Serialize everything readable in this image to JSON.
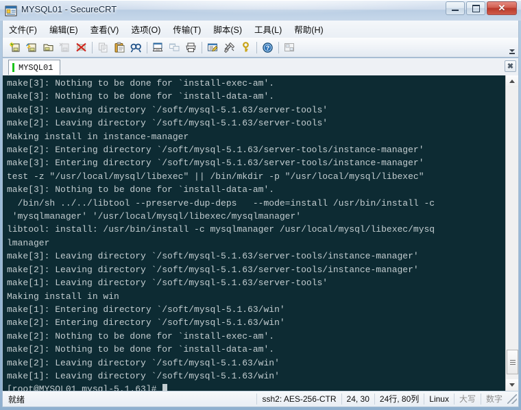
{
  "window": {
    "title": "MYSQL01 - SecureCRT",
    "icon": "securecrt-icon",
    "minimize_label": "–",
    "maximize_label": "□",
    "close_label": "✕"
  },
  "menubar": {
    "items": [
      {
        "label": "文件(F)",
        "name": "menu-file"
      },
      {
        "label": "编辑(E)",
        "name": "menu-edit"
      },
      {
        "label": "查看(V)",
        "name": "menu-view"
      },
      {
        "label": "选项(O)",
        "name": "menu-options"
      },
      {
        "label": "传输(T)",
        "name": "menu-transfer"
      },
      {
        "label": "脚本(S)",
        "name": "menu-script"
      },
      {
        "label": "工具(L)",
        "name": "menu-tools"
      },
      {
        "label": "帮助(H)",
        "name": "menu-help"
      }
    ]
  },
  "toolbar": {
    "buttons": [
      {
        "name": "new-session-icon",
        "kind": "icon"
      },
      {
        "name": "quick-connect-icon",
        "kind": "icon"
      },
      {
        "name": "connect-sftp-icon",
        "kind": "icon"
      },
      {
        "name": "reconnect-icon",
        "kind": "icon"
      },
      {
        "name": "disconnect-icon",
        "kind": "icon"
      },
      {
        "name": "separator-1",
        "kind": "sep"
      },
      {
        "name": "copy-icon",
        "kind": "icon"
      },
      {
        "name": "paste-icon",
        "kind": "icon"
      },
      {
        "name": "find-icon",
        "kind": "icon"
      },
      {
        "name": "separator-2",
        "kind": "sep"
      },
      {
        "name": "print-screen-icon",
        "kind": "icon"
      },
      {
        "name": "log-session-icon",
        "kind": "icon"
      },
      {
        "name": "print-icon",
        "kind": "icon"
      },
      {
        "name": "separator-3",
        "kind": "sep"
      },
      {
        "name": "session-options-icon",
        "kind": "icon"
      },
      {
        "name": "global-options-icon",
        "kind": "icon"
      },
      {
        "name": "key-icon",
        "kind": "icon"
      },
      {
        "name": "separator-4",
        "kind": "sep"
      },
      {
        "name": "help-icon",
        "kind": "icon"
      },
      {
        "name": "separator-5",
        "kind": "sep"
      },
      {
        "name": "tile-windows-icon",
        "kind": "icon"
      }
    ],
    "overflow_label": "toolbar-overflow"
  },
  "tabs": {
    "items": [
      {
        "label": "MYSQL01",
        "connected": true,
        "active": true
      }
    ],
    "close_label": "✖"
  },
  "terminal": {
    "background_color": "#0d2b33",
    "text_color": "#c3cdd0",
    "lines": [
      "make[3]: Nothing to be done for `install-exec-am'.",
      "make[3]: Nothing to be done for `install-data-am'.",
      "make[3]: Leaving directory `/soft/mysql-5.1.63/server-tools'",
      "make[2]: Leaving directory `/soft/mysql-5.1.63/server-tools'",
      "Making install in instance-manager",
      "make[2]: Entering directory `/soft/mysql-5.1.63/server-tools/instance-manager'",
      "make[3]: Entering directory `/soft/mysql-5.1.63/server-tools/instance-manager'",
      "test -z \"/usr/local/mysql/libexec\" || /bin/mkdir -p \"/usr/local/mysql/libexec\"",
      "make[3]: Nothing to be done for `install-data-am'.",
      "  /bin/sh ../../libtool --preserve-dup-deps   --mode=install /usr/bin/install -c",
      " 'mysqlmanager' '/usr/local/mysql/libexec/mysqlmanager'",
      "libtool: install: /usr/bin/install -c mysqlmanager /usr/local/mysql/libexec/mysq",
      "lmanager",
      "make[3]: Leaving directory `/soft/mysql-5.1.63/server-tools/instance-manager'",
      "make[2]: Leaving directory `/soft/mysql-5.1.63/server-tools/instance-manager'",
      "make[1]: Leaving directory `/soft/mysql-5.1.63/server-tools'",
      "Making install in win",
      "make[1]: Entering directory `/soft/mysql-5.1.63/win'",
      "make[2]: Entering directory `/soft/mysql-5.1.63/win'",
      "make[2]: Nothing to be done for `install-exec-am'.",
      "make[2]: Nothing to be done for `install-data-am'.",
      "make[2]: Leaving directory `/soft/mysql-5.1.63/win'",
      "make[1]: Leaving directory `/soft/mysql-5.1.63/win'",
      "[root@MYSQL01 mysql-5.1.63]# "
    ],
    "prompt_line_index": 23,
    "cursor_column": 29
  },
  "statusbar": {
    "ready": "就绪",
    "cipher": "ssh2: AES-256-CTR",
    "cursor_position": "24, 30",
    "dimensions": "24行, 80列",
    "emulation": "Linux",
    "caps": "大写",
    "num": "数字"
  }
}
